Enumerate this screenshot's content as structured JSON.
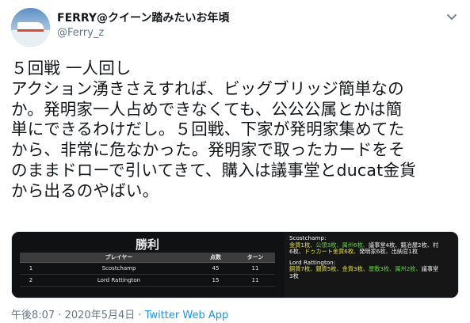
{
  "header": {
    "display_name": "FERRY@クイーン踏みたいお年頃",
    "handle": "@Ferry_z",
    "avatar_icon": "ship-avatar-icon",
    "menu_icon": "chevron-down-icon"
  },
  "tweet": {
    "lines": [
      "５回戦 一人回し",
      "アクション湧きさえすれば、ビッグブリッジ簡単なの",
      "か。発明家一人占めできなくても、公公公属とかは簡",
      "単にできるわけだし。５回戦、下家が発明家集めてた",
      "から、非常に危なかった。発明家で取ったカードをそ",
      "のままドローで引いてきて、購入は議事堂とducat金貨",
      "から出るのやばい。"
    ]
  },
  "result": {
    "title": "勝利",
    "headers": [
      "",
      "プレイヤー",
      "点数",
      "ターン"
    ],
    "rows": [
      [
        "1",
        "Scostchamp",
        "45",
        "11"
      ],
      [
        "2",
        "Lord Rattington",
        "15",
        "11"
      ]
    ]
  },
  "notes": {
    "p1_name": "Scostchamp:",
    "p1_line1": [
      {
        "t": "金貨1枚、",
        "c": "y"
      },
      {
        "t": "公領3枚、",
        "c": "g"
      },
      {
        "t": "属州6枚、",
        "c": "g"
      },
      {
        "t": "議事堂4枚、鍛冶屋2枚、村",
        "c": "w"
      }
    ],
    "p1_line2": [
      {
        "t": "6枚、",
        "c": "w"
      },
      {
        "t": "ドゥカート金貨6枚、",
        "c": "y"
      },
      {
        "t": "発明家6枚、出納官1枚",
        "c": "w"
      }
    ],
    "p2_name": "Lord Rattington:",
    "p2_line1": [
      {
        "t": "銅貨7枚、",
        "c": "y"
      },
      {
        "t": "銀貨5枚、",
        "c": "y"
      },
      {
        "t": "金貨3枚、",
        "c": "y"
      },
      {
        "t": "屋敷3枚、",
        "c": "g"
      },
      {
        "t": "属州2枚、",
        "c": "g"
      },
      {
        "t": "議事堂",
        "c": "w"
      }
    ],
    "p2_line2": [
      {
        "t": "3枚",
        "c": "w"
      }
    ]
  },
  "footer": {
    "time": "午後8:07",
    "separator": " · ",
    "date": "2020年5月4日",
    "separator2": " · ",
    "app": "Twitter Web App"
  },
  "colors": {
    "text": "#14171a",
    "muted": "#657786",
    "link": "#1b95e0",
    "victory_green": "#5ed43a",
    "treasure_yellow": "#e5e23a"
  }
}
